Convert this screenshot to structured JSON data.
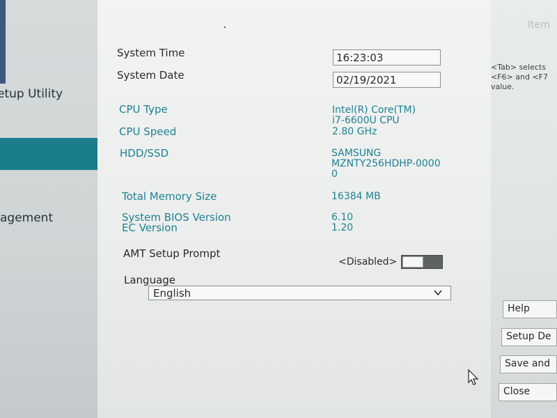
{
  "left_nav": {
    "title": "etup Utility",
    "item": "agement"
  },
  "main": {
    "system_time": {
      "label": "System Time",
      "value": "16:23:03"
    },
    "system_date": {
      "label": "System Date",
      "value": "02/19/2021"
    },
    "cpu_type": {
      "label": "CPU Type",
      "value_line1": "Intel(R) Core(TM)",
      "value_line2": "i7-6600U CPU"
    },
    "cpu_speed": {
      "label": "CPU Speed",
      "value": "2.80 GHz"
    },
    "hdd": {
      "label": "HDD/SSD",
      "value_line1": "SAMSUNG",
      "value_line2": "MZNTY256HDHP-0000",
      "value_line3": "0"
    },
    "memory": {
      "label": "Total Memory Size",
      "value": "16384 MB"
    },
    "bios": {
      "label": "System BIOS Version",
      "value": "6.10"
    },
    "ec": {
      "label": "EC Version",
      "value": "1.20"
    },
    "amt": {
      "label": "AMT Setup Prompt",
      "state": "<Disabled>",
      "enabled": false
    },
    "language": {
      "label": "Language",
      "value": "English"
    }
  },
  "right_panel": {
    "header": "Item",
    "help_line1": "<Tab> selects",
    "help_line2": "<F6> and <F7",
    "help_line3": "value.",
    "buttons": {
      "help": "Help",
      "setup_defaults": "Setup De",
      "save_and": "Save and",
      "close": "Close"
    }
  },
  "colors": {
    "teal": "#1d8192",
    "highlight": "#1b7d8c"
  }
}
